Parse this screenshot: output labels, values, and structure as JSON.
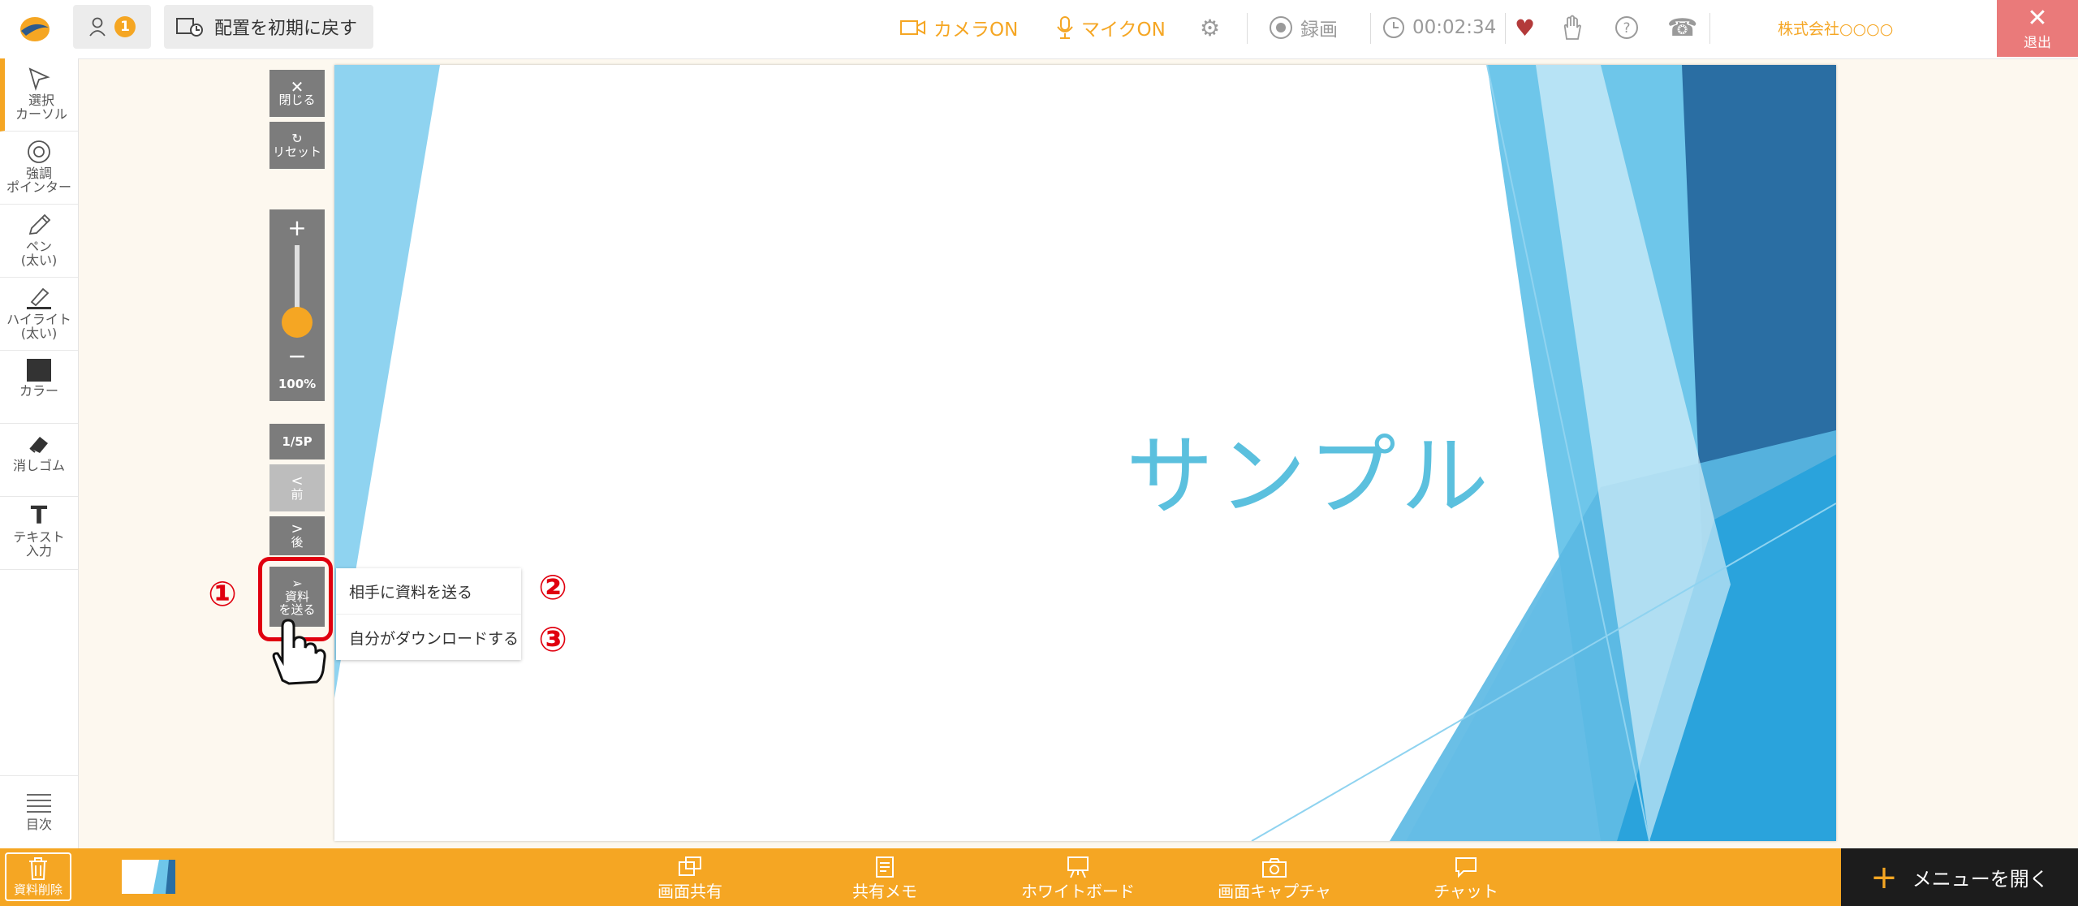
{
  "topbar": {
    "users_count": "1",
    "reset_layout_label": "配置を初期に戻す",
    "camera_label": "カメラON",
    "mic_label": "マイクON",
    "record_label": "録画",
    "timer": "00:02:34",
    "company": "株式会社○○○○",
    "exit_label": "退出",
    "accent_color": "#f5a623",
    "exit_color": "#ea7a7a"
  },
  "tools": [
    {
      "label": "選択\nカーソル",
      "icon": "cursor-icon"
    },
    {
      "label": "強調\nポインター",
      "icon": "pointer-icon"
    },
    {
      "label": "ペン\n(太い)",
      "icon": "pen-icon"
    },
    {
      "label": "ハイライト\n(太い)",
      "icon": "highlight-icon"
    },
    {
      "label": "カラー",
      "icon": "color-icon"
    },
    {
      "label": "消しゴム",
      "icon": "eraser-icon"
    },
    {
      "label": "テキスト\n入力",
      "icon": "text-icon"
    }
  ],
  "toc_label": "目次",
  "slide_controls": {
    "close_label": "閉じる",
    "reset_label": "リセット",
    "zoom_plus": "+",
    "zoom_minus": "−",
    "zoom_level": "100%",
    "page": "1/5P",
    "prev_label": "前",
    "next_label": "後",
    "send_label": "資料\nを送る"
  },
  "send_menu": {
    "send_to_partner": "相手に資料を送る",
    "download_self": "自分がダウンロードする"
  },
  "annotations": [
    "①",
    "②",
    "③"
  ],
  "slide": {
    "title": "サンプル"
  },
  "bottombar": {
    "delete_label": "資料削除",
    "items": [
      "画面共有",
      "共有メモ",
      "ホワイトボード",
      "画面キャプチャ",
      "チャット"
    ],
    "open_menu_label": "メニューを開く"
  }
}
